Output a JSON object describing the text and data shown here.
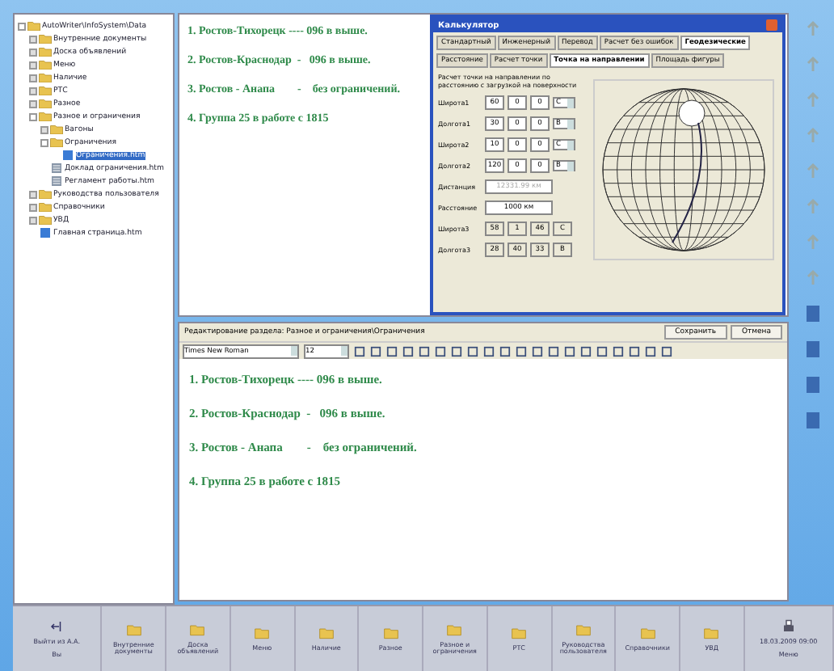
{
  "tree": {
    "label": "AutoWriter\\InfoSystem\\Data",
    "expanded": true,
    "children": [
      {
        "label": "Внутренние документы",
        "kind": "folder",
        "expanded": false
      },
      {
        "label": "Доска объявлений",
        "kind": "folder",
        "expanded": false
      },
      {
        "label": "Меню",
        "kind": "folder",
        "expanded": false
      },
      {
        "label": "Наличие",
        "kind": "folder",
        "expanded": false
      },
      {
        "label": "РТС",
        "kind": "folder",
        "expanded": false
      },
      {
        "label": "Разное",
        "kind": "folder",
        "expanded": false
      },
      {
        "label": "Разное и ограничения",
        "kind": "folder",
        "expanded": true,
        "children": [
          {
            "label": "Вагоны",
            "kind": "folder",
            "expanded": false
          },
          {
            "label": "Ограничения",
            "kind": "folder",
            "expanded": true,
            "children": [
              {
                "label": "Ограничения.htm",
                "kind": "page",
                "selected": true
              }
            ]
          },
          {
            "label": "Доклад ограничения.htm",
            "kind": "doc",
            "selected": false
          },
          {
            "label": "Регламент работы.htm",
            "kind": "doc",
            "selected": false
          }
        ]
      },
      {
        "label": "Руководства пользователя",
        "kind": "folder",
        "expanded": false
      },
      {
        "label": "Справочники",
        "kind": "folder",
        "expanded": false
      },
      {
        "label": "УВД",
        "kind": "folder",
        "expanded": false
      },
      {
        "label": "Главная страница.htm",
        "kind": "page",
        "selected": false
      }
    ]
  },
  "preview": [
    "1. Ростов-Тихорецк ---- 096 в выше.",
    "2. Ростов-Краснодар  -   096 в выше.",
    "3. Ростов - Анапа        -    без ограничений.",
    "4. Группа 25 в работе с 1815"
  ],
  "dialog": {
    "title": "Калькулятор",
    "tabs": [
      {
        "label": "Стандартный",
        "selected": false
      },
      {
        "label": "Инженерный",
        "selected": false
      },
      {
        "label": "Перевод",
        "selected": false
      },
      {
        "label": "Расчет без ошибок",
        "selected": false
      },
      {
        "label": "Геодезические",
        "selected": true
      }
    ],
    "subtabs": [
      {
        "label": "Расстояние",
        "selected": false
      },
      {
        "label": "Расчет точки",
        "selected": false
      },
      {
        "label": "Точка на направлении",
        "selected": true
      },
      {
        "label": "Площадь фигуры",
        "selected": false
      }
    ],
    "description": "Расчет точки на направлении по расстоянию с загрузкой на поверхности",
    "rows": [
      {
        "kind": "coord",
        "label": "Широта1",
        "values": [
          "60",
          "0",
          "0"
        ],
        "hemi": "С"
      },
      {
        "kind": "coord",
        "label": "Долгота1",
        "values": [
          "30",
          "0",
          "0"
        ],
        "hemi": "В"
      },
      {
        "kind": "coord",
        "label": "Широта2",
        "values": [
          "10",
          "0",
          "0"
        ],
        "hemi": "С"
      },
      {
        "kind": "coord",
        "label": "Долгота2",
        "values": [
          "120",
          "0",
          "0"
        ],
        "hemi": "В"
      },
      {
        "kind": "wide",
        "label": "Дистанция",
        "value": "12331.99 км",
        "disabled": true
      },
      {
        "kind": "wide",
        "label": "Расстояние",
        "value": "1000 км",
        "disabled": false
      },
      {
        "kind": "result",
        "label": "Широта3",
        "values": [
          "58",
          "1",
          "46"
        ],
        "hemi": "С"
      },
      {
        "kind": "result",
        "label": "Долгота3",
        "values": [
          "28",
          "40",
          "33"
        ],
        "hemi": "В"
      }
    ]
  },
  "editor": {
    "path": "Редактирование раздела: Разное и ограничения\\Ограничения",
    "buttons": [
      "Сохранить",
      "Отмена"
    ],
    "font": "Times New Roman",
    "size": "12",
    "lines": [
      "1. Ростов-Тихорецк ---- 096 в выше.",
      "2. Ростов-Краснодар  -   096 в выше.",
      "3. Ростов - Анапа        -    без ограничений.",
      "4. Группа 25 в работе с 1815"
    ]
  },
  "taskbar": {
    "left": "Выйти из А.А.",
    "left_sub": "Вы",
    "items": [
      "Внутренние документы",
      "Доска объявлений",
      "Меню",
      "Наличие",
      "Разное",
      "Разное и ограничения",
      "РТС",
      "Руководства пользователя",
      "Справочники",
      "УВД"
    ],
    "right": "18.03.2009 09:00",
    "right_sub": "Меню"
  }
}
